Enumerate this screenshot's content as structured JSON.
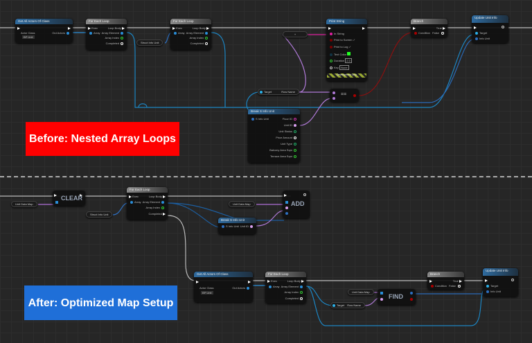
{
  "before": {
    "label": "Before: Nested Array Loops",
    "label_color": "#ff0000",
    "get_all_actors": {
      "title": "Get All Actors Of Class",
      "actor_class": "Actor Class",
      "actor_class_value": "BP Unit",
      "out_actors": "Out Actors"
    },
    "loop1": {
      "title": "For Each Loop",
      "exec": "Exec",
      "array": "Array",
      "loop_body": "Loop Body",
      "array_element": "Array Element",
      "array_index": "Array Index",
      "completed": "Completed"
    },
    "struct_pill": "Struct Info Unit",
    "loop2": {
      "title": "For Each Loop",
      "exec": "Exec",
      "array": "Array",
      "loop_body": "Loop Body",
      "array_element": "Array Element",
      "array_index": "Array Index",
      "completed": "Completed"
    },
    "append": "+",
    "print_string": {
      "title": "Print String",
      "in_string": "In String",
      "print_screen": "Print to Screen",
      "print_log": "Print to Log",
      "text_color": "Text Color",
      "duration": "Duration",
      "duration_value": "2.0",
      "key": "Key",
      "key_value": "None",
      "dev_only": "Development Only"
    },
    "branch": {
      "title": "Branch",
      "condition": "Condition",
      "true": "True",
      "false": "False"
    },
    "update": {
      "title": "Update Unit Info",
      "target": "Target",
      "info_unit": "Info Unit"
    },
    "row_name": {
      "target": "Target",
      "row_name": "Row Name"
    },
    "equals": "==",
    "break": {
      "title": "Break S Info Unit",
      "input": "S Info Unit",
      "outputs": [
        "Floor ID",
        "Unit ID",
        "Unit Status",
        "Price Amount",
        "Unit Type",
        "Balcony Area Sqm",
        "Terrace Area Sqm"
      ]
    }
  },
  "after": {
    "label": "After: Optimized Map Setup",
    "label_color": "#1f6fd8",
    "map_pill1": "Unit Data Map",
    "clear": "CLEAR",
    "struct_pill": "Struct Info Unit",
    "loop1": {
      "title": "For Each Loop",
      "exec": "Exec",
      "array": "Array",
      "loop_body": "Loop Body",
      "array_element": "Array Element",
      "array_index": "Array Index",
      "completed": "Completed"
    },
    "map_pill2": "Unit Data Map",
    "add": "ADD",
    "break": {
      "title": "Break S Info Unit",
      "input": "S Info Unit",
      "output": "Unit ID"
    },
    "get_all_actors": {
      "title": "Get All Actors Of Class",
      "actor_class": "Actor Class",
      "actor_class_value": "BP Unit",
      "out_actors": "Out Actors"
    },
    "loop2": {
      "title": "For Each Loop",
      "exec": "Exec",
      "array": "Array",
      "loop_body": "Loop Body",
      "array_element": "Array Element",
      "array_index": "Array Index",
      "completed": "Completed"
    },
    "map_pill3": "Unit Data Map",
    "find": "FIND",
    "row_name": {
      "target": "Target",
      "row_name": "Row Name"
    },
    "branch": {
      "title": "Branch",
      "condition": "Condition",
      "true": "True",
      "false": "False"
    },
    "update": {
      "title": "Update Unit Info",
      "target": "Target",
      "info_unit": "Info Unit"
    }
  }
}
